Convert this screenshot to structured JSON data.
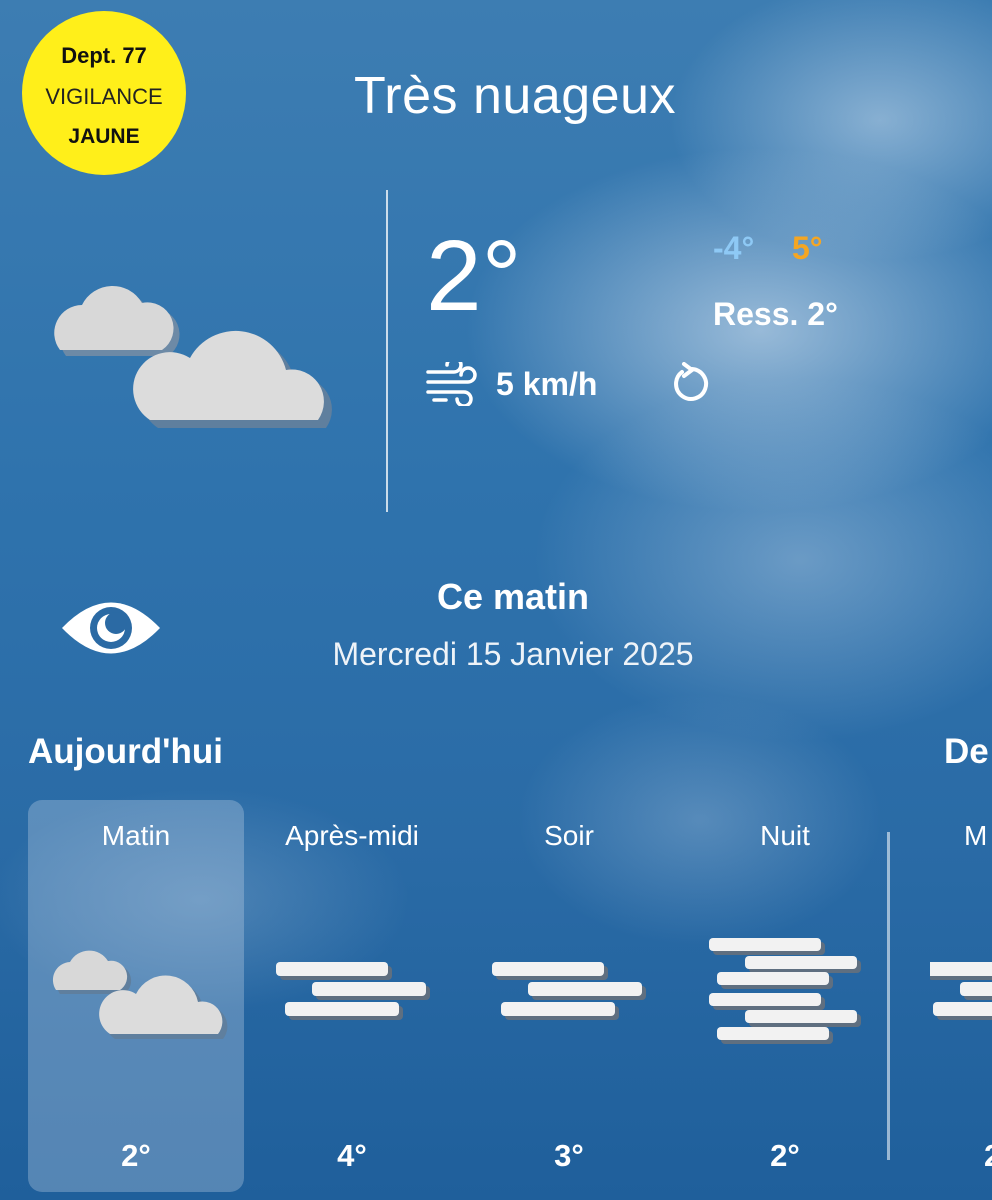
{
  "vigilance": {
    "dept": "Dept. 77",
    "label": "VIGILANCE",
    "level": "JAUNE",
    "color": "#ffef1a"
  },
  "current": {
    "condition": "Très nuageux",
    "icon": "cloudy-icon",
    "temperature": "2°",
    "min": "-4°",
    "max": "5°",
    "feels_like": "Ress. 2°",
    "wind": "5 km/h",
    "colors": {
      "min": "#8ec9f5",
      "max": "#f5a623"
    }
  },
  "period": {
    "title": "Ce matin",
    "date": "Mercredi 15 Janvier 2025"
  },
  "forecast": {
    "today_title": "Aujourd'hui",
    "next_title": "De",
    "slots": [
      {
        "label": "Matin",
        "temp": "2°",
        "icon": "cloudy-icon",
        "active": true
      },
      {
        "label": "Après-midi",
        "temp": "4°",
        "icon": "fog-icon"
      },
      {
        "label": "Soir",
        "temp": "3°",
        "icon": "fog-icon"
      },
      {
        "label": "Nuit",
        "temp": "2°",
        "icon": "dense-fog-icon"
      }
    ],
    "next_slot": {
      "label": "M",
      "temp": "2",
      "icon": "fog-icon"
    }
  }
}
